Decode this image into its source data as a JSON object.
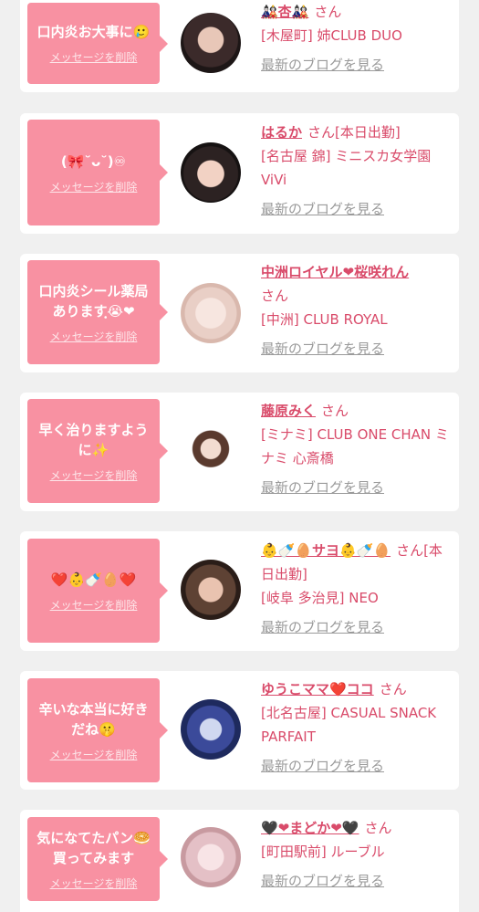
{
  "delete_label": "メッセージを削除",
  "san_label": "さん",
  "blog_label": "最新のブログを見る",
  "colors": {
    "bubble": "#f891a2",
    "accent": "#d94b6a",
    "muted": "#9a9a9a",
    "background": "#f0f0f0"
  },
  "entries": [
    {
      "message": "口内炎お大事に🥲",
      "name": "🎎杏🎎",
      "status": "",
      "shop": "[木屋町] 姉CLUB DUO"
    },
    {
      "message": "(🎀˘ᴗ˘)♾",
      "name": "はるか",
      "status": "[本日出勤]",
      "shop": "[名古屋 錦] ミニスカ女学園ViVi"
    },
    {
      "message": "口内炎シール薬局ありますฺ😭❤",
      "name": "中洲ロイヤル❤桜咲れん",
      "status": "",
      "shop": "[中洲] CLUB ROYAL"
    },
    {
      "message": "早く治りますように✨",
      "name": "藤原みく",
      "status": "",
      "shop": "[ミナミ] CLUB ONE CHAN ミナミ 心斎橋"
    },
    {
      "message": "❤️👶🍼🥚❤️",
      "name": "👶🍼🥚サヨ👶🍼🥚",
      "status": "[本日出勤]",
      "shop": "[岐阜 多治見] NEO"
    },
    {
      "message": "辛いな本当に好きだね🤫",
      "name": "ゆうこママ❤️ココ",
      "status": "",
      "shop": "[北名古屋] CASUAL SNACK PARFAIT"
    },
    {
      "message": "気になてたパン🥯買ってみます",
      "name": "🖤❤まどか❤🖤",
      "status": "",
      "shop": "[町田駅前] ルーブル"
    }
  ]
}
